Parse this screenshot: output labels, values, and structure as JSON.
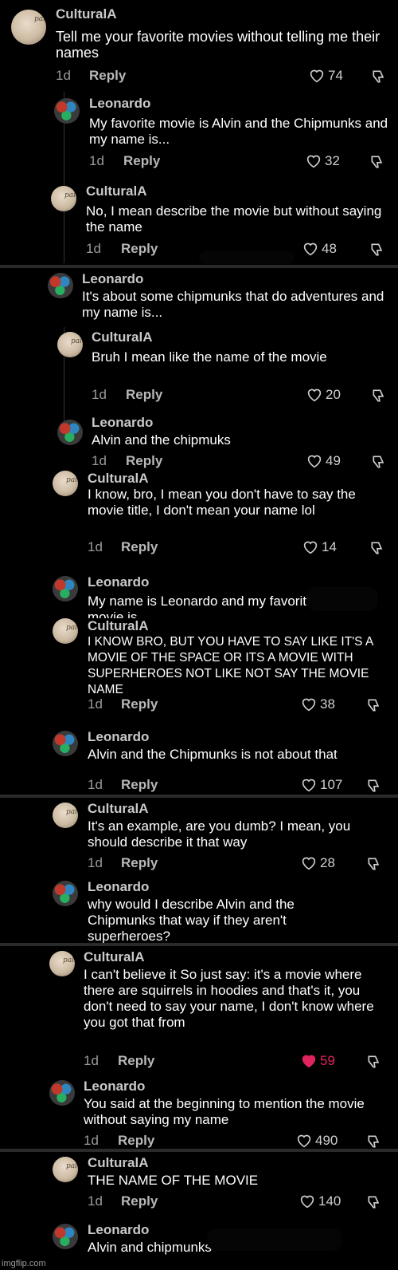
{
  "comments": [
    {
      "user": "CulturalA",
      "text": "Tell me your favorite movies without telling me their names",
      "time": "1d",
      "reply": "Reply",
      "likes": "74",
      "liked": false
    },
    {
      "user": "Leonardo",
      "text": "My favorite movie is Alvin and the Chipmunks and my name is...",
      "time": "1d",
      "reply": "Reply",
      "likes": "32",
      "liked": false
    },
    {
      "user": "CulturalA",
      "text": "No, I mean describe the movie but without saying the name",
      "time": "1d",
      "reply": "Reply",
      "likes": "48",
      "liked": false
    },
    {
      "user": "Leonardo",
      "text": "It's about some chipmunks that do adventures and my name is...",
      "time": "",
      "reply": "",
      "likes": "",
      "liked": false
    },
    {
      "user": "CulturalA",
      "text": "Bruh I mean like the name of the movie",
      "time": "1d",
      "reply": "Reply",
      "likes": "20",
      "liked": false
    },
    {
      "user": "Leonardo",
      "text": "Alvin and the chipmuks",
      "time": "1d",
      "reply": "Reply",
      "likes": "49",
      "liked": false
    },
    {
      "user": "CulturalA",
      "text": "I know, bro, I mean you don't have to say the movie title, I don't mean your name lol",
      "time": "1d",
      "reply": "Reply",
      "likes": "14",
      "liked": false
    },
    {
      "user": "Leonardo",
      "text": "My name is Leonardo and my favorite movie is...",
      "time": "",
      "reply": "",
      "likes": "",
      "liked": false
    },
    {
      "user": "CulturalA",
      "text": "I KNOW BRO, BUT YOU HAVE TO SAY LIKE IT'S A MOVIE OF THE SPACE OR ITS A MOVIE WITH SUPERHEROES NOT LIKE NOT SAY THE MOVIE NAME",
      "time": "1d",
      "reply": "Reply",
      "likes": "38",
      "liked": false
    },
    {
      "user": "Leonardo",
      "text": "Alvin and the Chipmunks is not about that",
      "time": "1d",
      "reply": "Reply",
      "likes": "107",
      "liked": false
    },
    {
      "user": "CulturalA",
      "text": "It's an example, are you dumb? I mean, you should describe it that way",
      "time": "1d",
      "reply": "Reply",
      "likes": "28",
      "liked": false
    },
    {
      "user": "Leonardo",
      "text": "why would I describe Alvin and the Chipmunks that way if they aren't superheroes?",
      "time": "",
      "reply": "",
      "likes": "",
      "liked": false
    },
    {
      "user": "CulturalA",
      "text": "I can't believe it So just say: it's a movie where there are squirrels in hoodies and that's it, you don't need to say your name, I don't know where you got that from",
      "time": "1d",
      "reply": "Reply",
      "likes": "59",
      "liked": true
    },
    {
      "user": "Leonardo",
      "text": "You said at the beginning to mention the movie without saying my name",
      "time": "1d",
      "reply": "Reply",
      "likes": "490",
      "liked": false
    },
    {
      "user": "CulturalA",
      "text": "THE NAME OF THE MOVIE",
      "time": "1d",
      "reply": "Reply",
      "likes": "140",
      "liked": false
    },
    {
      "user": "Leonardo",
      "text": "Alvin and chipmunks",
      "time": "",
      "reply": "",
      "likes": "",
      "liked": false
    }
  ],
  "avatar_text": "pal",
  "like_color": "#e0245e",
  "watermark": "imgflip.com"
}
